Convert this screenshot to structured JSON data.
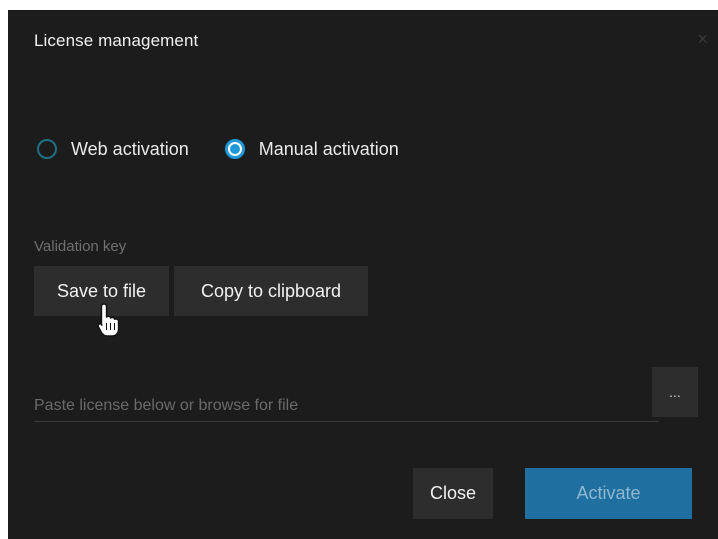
{
  "dialog": {
    "title": "License management",
    "close_glyph": "×"
  },
  "activation": {
    "options": [
      {
        "label": "Web activation",
        "selected": false
      },
      {
        "label": "Manual activation",
        "selected": true
      }
    ]
  },
  "validation": {
    "label": "Validation key",
    "save_label": "Save to file",
    "copy_label": "Copy to clipboard"
  },
  "license": {
    "placeholder": "Paste license below or browse for file",
    "value": "",
    "browse_label": "..."
  },
  "footer": {
    "close_label": "Close",
    "activate_label": "Activate"
  },
  "colors": {
    "background": "#1c1c1c",
    "accent": "#1f98d8",
    "button": "#2d2d2d",
    "activate": "#1f6fa0"
  },
  "icons": {
    "cursor": "hand-pointer-cursor-icon",
    "close": "close-icon"
  }
}
